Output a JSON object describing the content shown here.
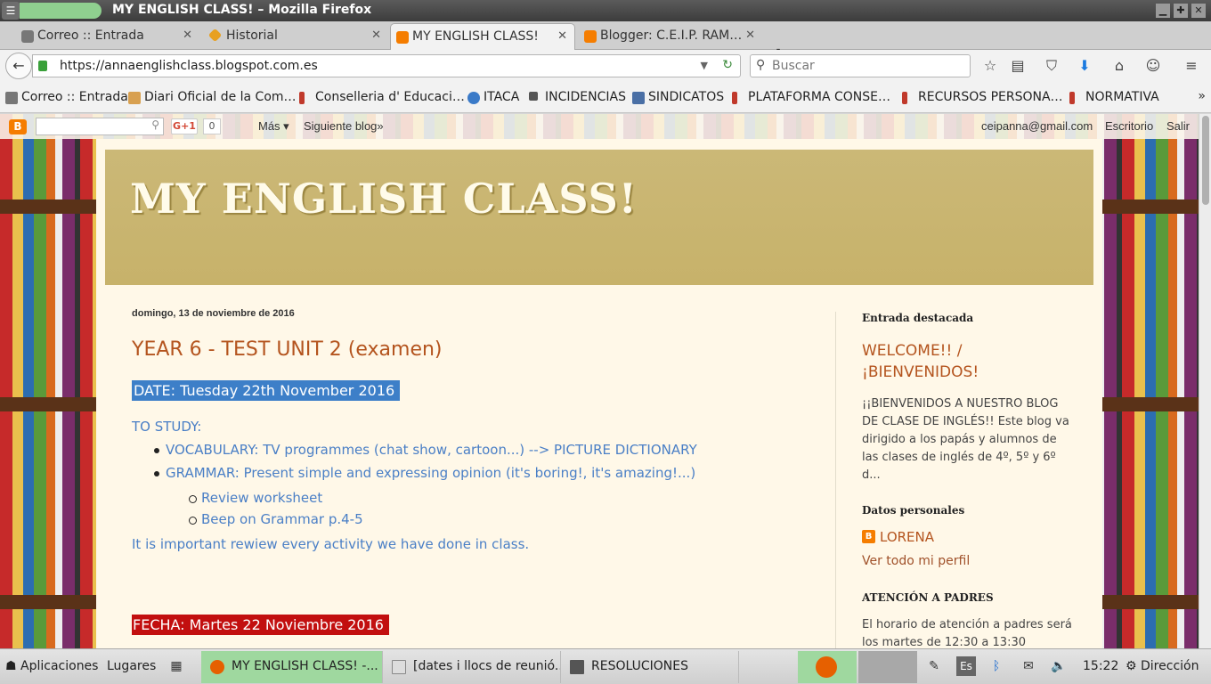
{
  "window": {
    "title": "MY ENGLISH CLASS! – Mozilla Firefox"
  },
  "tabs": [
    {
      "label": "Correo :: Entrada",
      "icon": "mail-icon",
      "color": "#555555"
    },
    {
      "label": "Historial",
      "icon": "history-icon",
      "color": "#e8a020"
    },
    {
      "label": "MY ENGLISH CLASS!",
      "icon": "blogger-icon",
      "color": "#f57d00"
    },
    {
      "label": "Blogger: C.E.I.P. RAM…",
      "icon": "blogger-icon",
      "color": "#f57d00"
    }
  ],
  "navbar": {
    "url": "https://annaenglishclass.blogspot.com.es",
    "search_placeholder": "Buscar"
  },
  "bookmarks": [
    {
      "label": "Correo :: Entrada",
      "icon": "mail-icon"
    },
    {
      "label": "Diari Oficial de la Com…",
      "icon": "bookmark-icon"
    },
    {
      "label": "Conselleria d' Educaci…",
      "icon": "bookmark-icon"
    },
    {
      "label": "ITACA",
      "icon": "globe-icon"
    },
    {
      "label": "INCIDENCIAS",
      "icon": "bookmark-icon"
    },
    {
      "label": "SINDICATOS",
      "icon": "bookmark-icon"
    },
    {
      "label": "PLATAFORMA CONSE…",
      "icon": "bookmark-icon"
    },
    {
      "label": "RECURSOS PERSONA…",
      "icon": "bookmark-icon"
    },
    {
      "label": "NORMATIVA",
      "icon": "bookmark-icon"
    }
  ],
  "blognav": {
    "gplus": "G+1",
    "gplus_count": "0",
    "more": "Más ▾",
    "next_blog": "Siguiente blog»",
    "email": "ceipanna@gmail.com",
    "desktop": "Escritorio",
    "logout": "Salir"
  },
  "blog": {
    "title": "MY ENGLISH CLASS!",
    "post": {
      "date": "domingo, 13 de noviembre de 2016",
      "title": "YEAR 6 - TEST UNIT 2 (examen)",
      "date_line": "DATE: Tuesday 22th November 2016",
      "to_study": "TO STUDY:",
      "vocabulary": "VOCABULARY: TV programmes (chat show, cartoon...) --> PICTURE DICTIONARY",
      "grammar": "GRAMMAR: Present simple and expressing opinion (it's boring!, it's amazing!...)",
      "sub_items": [
        "Review worksheet",
        "Beep on Grammar p.4-5"
      ],
      "important": "It is important rewiew every activity we have done in class.",
      "fecha": "FECHA: Martes 22 Noviembre 2016"
    },
    "sidebar": {
      "featured_title": "Entrada destacada",
      "welcome": "WELCOME!! / ¡BIENVENIDOS!",
      "welcome_text": "¡¡BIENVENIDOS A NUESTRO BLOG DE CLASE DE INGLÉS!! Este blog va dirigido a los papás y alumnos de las clases de inglés de 4º, 5º y 6º d...",
      "personal_title": "Datos personales",
      "profile_name": "LORENA",
      "profile_link": "Ver todo mi perfil",
      "parents_title": "ATENCIÓN A PADRES",
      "parents_text": "El horario de atención a padres será los martes de 12:30 a 13:30"
    }
  },
  "taskbar": {
    "apps": "Aplicaciones",
    "places": "Lugares",
    "windows": [
      {
        "label": "MY ENGLISH CLASS! -...",
        "active": true
      },
      {
        "label": "[dates i llocs de reunió....",
        "active": false
      },
      {
        "label": "RESOLUCIONES",
        "active": false
      }
    ],
    "lang": "Es",
    "clock": "15:22",
    "user": "Dirección"
  },
  "colors": {
    "accent_green": "#9fd89f",
    "post_title": "#b4541e",
    "blue_text": "#4a7fc6",
    "highlight_blue": "#3d7fc8",
    "highlight_red": "#c20f0f"
  }
}
